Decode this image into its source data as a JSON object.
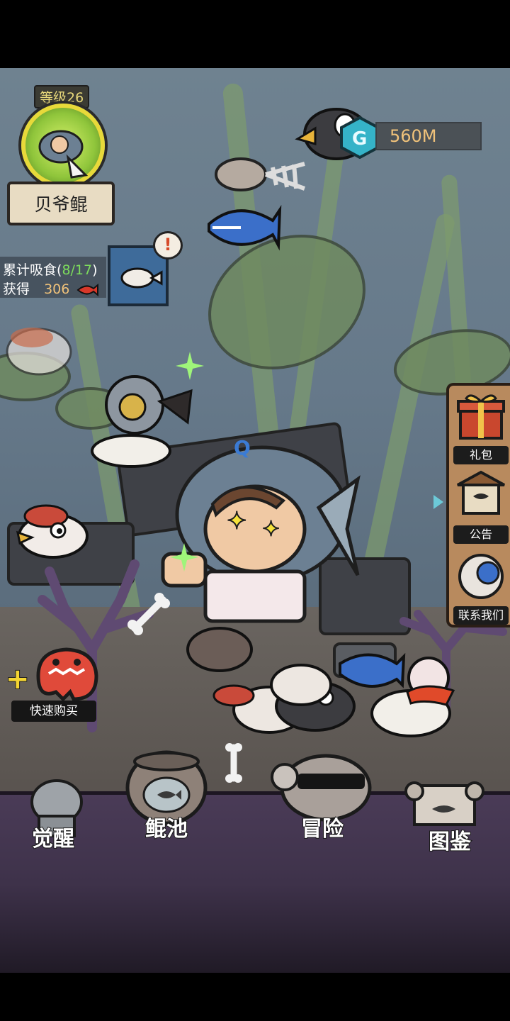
{
  "player": {
    "level_label": "等级26",
    "name": "贝爷鲲"
  },
  "currency": {
    "value": "560M",
    "icon": "g-gem-icon"
  },
  "eat_stats": {
    "cumulative_label": "累计吸食",
    "progress_open": "(",
    "progress_current": "8/17",
    "progress_close": ")",
    "obtained_label": "获得",
    "obtained_value": "306",
    "obtained_icon": "red-fish-icon"
  },
  "right_menu": [
    {
      "label": "礼包",
      "icon": "gift-box-icon"
    },
    {
      "label": "公告",
      "icon": "notice-board-icon"
    },
    {
      "label": "联系我们",
      "icon": "contact-fish-icon"
    }
  ],
  "quick_buy": {
    "label": "快速购买",
    "plus": "+"
  },
  "bottom_nav": [
    {
      "label": "觉醒",
      "icon": "awaken-statue-icon"
    },
    {
      "label": "鲲池",
      "icon": "fish-pool-jar-icon"
    },
    {
      "label": "冒险",
      "icon": "adventure-skull-icon"
    },
    {
      "label": "图鉴",
      "icon": "scroll-map-icon"
    }
  ],
  "colors": {
    "level_gold": "#e6d77a",
    "currency_text": "#f0c27a",
    "progress_green": "#7ddc5c",
    "menu_panel": "#b88a5e",
    "dock_purple": "#4a3b57"
  }
}
